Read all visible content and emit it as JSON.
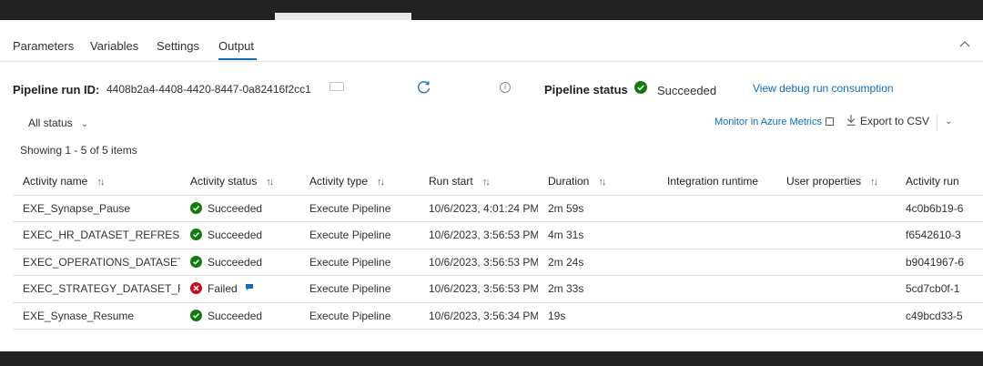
{
  "tabs": [
    {
      "label": "Parameters"
    },
    {
      "label": "Variables"
    },
    {
      "label": "Settings"
    },
    {
      "label": "Output"
    }
  ],
  "active_tab": "Output",
  "run": {
    "label": "Pipeline run ID:",
    "id": "4408b2a4-4408-4420-8447-0a82416f2cc1"
  },
  "pipeline_status": {
    "label": "Pipeline status",
    "value": "Succeeded"
  },
  "debug_link": "View debug run consumption",
  "filter": {
    "label": "All status"
  },
  "monitor_link": "Monitor in Azure Metrics",
  "export_label": "Export to CSV",
  "count_text": "Showing 1 - 5 of 5 items",
  "table": {
    "columns": [
      "Activity name",
      "Activity status",
      "Activity type",
      "Run start",
      "Duration",
      "Integration runtime",
      "User properties",
      "Activity run"
    ],
    "sortable": [
      true,
      true,
      true,
      true,
      true,
      false,
      true,
      false
    ],
    "rows": [
      {
        "name": "EXE_Synapse_Pause",
        "status": "Succeeded",
        "type": "Execute Pipeline",
        "start": "10/6/2023, 4:01:24 PM",
        "duration": "2m 59s",
        "runtime": "",
        "props": "",
        "run_id": "4c0b6b19-6"
      },
      {
        "name": "EXEC_HR_DATASET_REFRESH",
        "status": "Succeeded",
        "type": "Execute Pipeline",
        "start": "10/6/2023, 3:56:53 PM",
        "duration": "4m 31s",
        "runtime": "",
        "props": "",
        "run_id": "f6542610-3"
      },
      {
        "name": "EXEC_OPERATIONS_DATASET…",
        "status": "Succeeded",
        "type": "Execute Pipeline",
        "start": "10/6/2023, 3:56:53 PM",
        "duration": "2m 24s",
        "runtime": "",
        "props": "",
        "run_id": "b9041967-6"
      },
      {
        "name": "EXEC_STRATEGY_DATASET_RE…",
        "status": "Failed",
        "type": "Execute Pipeline",
        "start": "10/6/2023, 3:56:53 PM",
        "duration": "2m 33s",
        "runtime": "",
        "props": "",
        "run_id": "5cd7cb0f-1"
      },
      {
        "name": "EXE_Synase_Resume",
        "status": "Succeeded",
        "type": "Execute Pipeline",
        "start": "10/6/2023, 3:56:34 PM",
        "duration": "19s",
        "runtime": "",
        "props": "",
        "run_id": "c49bcd33-5"
      }
    ]
  },
  "colors": {
    "success": "#107c10",
    "failed": "#c50f1f",
    "accent": "#0f6cbd"
  },
  "icons": {
    "copy": "copy-icon",
    "refresh": "refresh-icon",
    "info": "info-icon",
    "success": "checkmark-circle-icon",
    "failed": "error-circle-icon",
    "external": "open-external-icon",
    "download": "download-icon",
    "sort": "sort-arrows-icon"
  }
}
